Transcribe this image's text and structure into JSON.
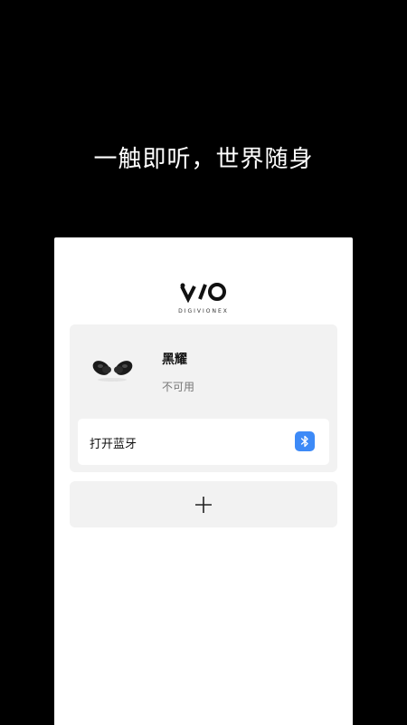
{
  "slogan": "一触即听，世界随身",
  "brand": {
    "logo_mark": "VIO",
    "logo_sub": "DIGIVIONEX"
  },
  "device": {
    "name": "黑耀",
    "status": "不可用",
    "image_icon": "earbuds-icon"
  },
  "bluetooth": {
    "label": "打开蓝牙",
    "icon": "bluetooth-icon",
    "accent_color": "#3d8af7"
  },
  "add": {
    "icon": "plus-icon"
  }
}
